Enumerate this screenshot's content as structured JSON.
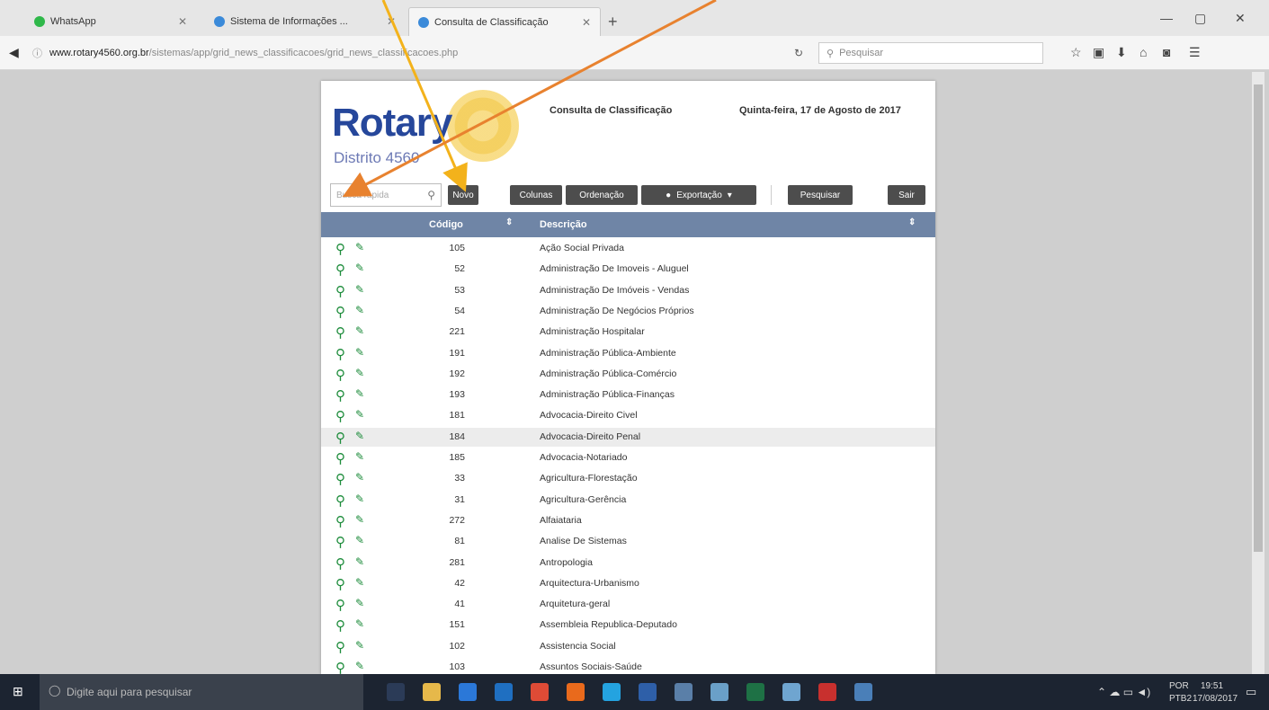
{
  "browser": {
    "tabs": [
      "WhatsApp",
      "Sistema de Informações ...",
      "Consulta de Classificação"
    ],
    "url_domain": "www.rotary4560.org.br",
    "url_path": "/sistemas/app/grid_news_classificacoes/grid_news_classificacoes.php",
    "search_placeholder": "Pesquisar"
  },
  "header": {
    "logo": "Rotary",
    "district": "Distrito 4560",
    "title": "Consulta de Classificação",
    "date": "Quinta-feira, 17 de Agosto de 2017"
  },
  "toolbar": {
    "search_placeholder": "Busca rápida",
    "novo": "Novo",
    "colunas": "Colunas",
    "ordenacao": "Ordenação",
    "exportacao": "Exportação",
    "pesquisar": "Pesquisar",
    "sair": "Sair"
  },
  "grid": {
    "col_code": "Código",
    "col_desc": "Descrição",
    "rows": [
      {
        "code": "105",
        "desc": "Ação Social Privada"
      },
      {
        "code": "52",
        "desc": "Administração De Imoveis - Aluguel"
      },
      {
        "code": "53",
        "desc": "Administração De Imóveis - Vendas"
      },
      {
        "code": "54",
        "desc": "Administração De Negócios Próprios"
      },
      {
        "code": "221",
        "desc": "Administração Hospitalar"
      },
      {
        "code": "191",
        "desc": "Administração Pública-Ambiente"
      },
      {
        "code": "192",
        "desc": "Administração Pública-Comércio"
      },
      {
        "code": "193",
        "desc": "Administração Pública-Finanças"
      },
      {
        "code": "181",
        "desc": "Advocacia-Direito Civel"
      },
      {
        "code": "184",
        "desc": "Advocacia-Direito Penal"
      },
      {
        "code": "185",
        "desc": "Advocacia-Notariado"
      },
      {
        "code": "33",
        "desc": "Agricultura-Florestação"
      },
      {
        "code": "31",
        "desc": "Agricultura-Gerência"
      },
      {
        "code": "272",
        "desc": "Alfaiataria"
      },
      {
        "code": "81",
        "desc": "Analise De Sistemas"
      },
      {
        "code": "281",
        "desc": "Antropologia"
      },
      {
        "code": "42",
        "desc": "Arquitectura-Urbanismo"
      },
      {
        "code": "41",
        "desc": "Arquitetura-geral"
      },
      {
        "code": "151",
        "desc": "Assembleia Republica-Deputado"
      },
      {
        "code": "102",
        "desc": "Assistencia Social"
      },
      {
        "code": "103",
        "desc": "Assuntos Sociais-Saúde"
      }
    ]
  },
  "taskbar": {
    "search": "Digite aqui para pesquisar",
    "lang1": "POR",
    "lang2": "PTB2",
    "time": "19:51",
    "date": "17/08/2017"
  }
}
